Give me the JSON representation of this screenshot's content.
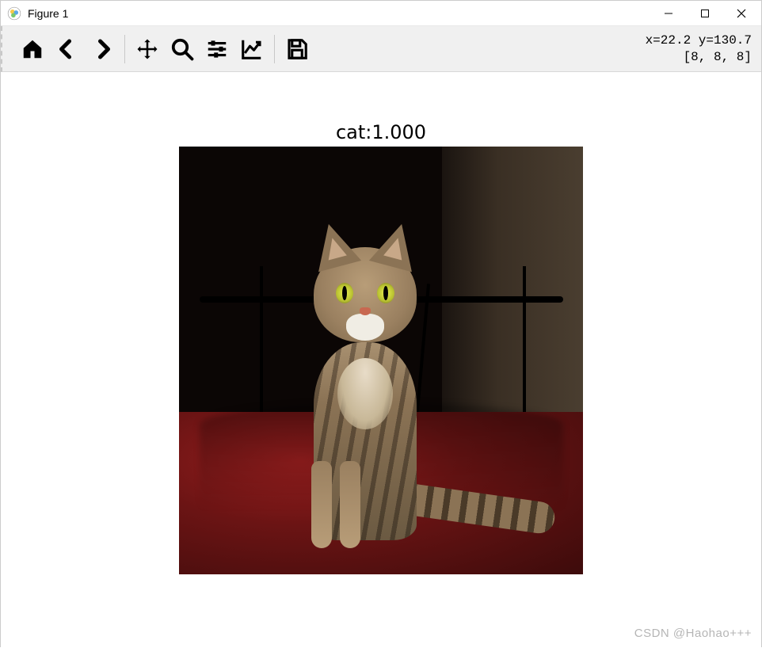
{
  "window": {
    "title": "Figure 1"
  },
  "toolbar": {
    "icons": {
      "home": "home-icon",
      "back": "back-icon",
      "forward": "forward-icon",
      "pan": "move-icon",
      "zoom": "zoom-icon",
      "subplots": "sliders-icon",
      "axes": "chart-icon",
      "save": "save-icon"
    },
    "status_coords": "x=22.2 y=130.7",
    "status_pixel": "[8, 8, 8]"
  },
  "figure": {
    "title": "cat:1.000",
    "image_description": "tabby cat sitting on red bed"
  },
  "watermark": "CSDN @Haohao+++"
}
